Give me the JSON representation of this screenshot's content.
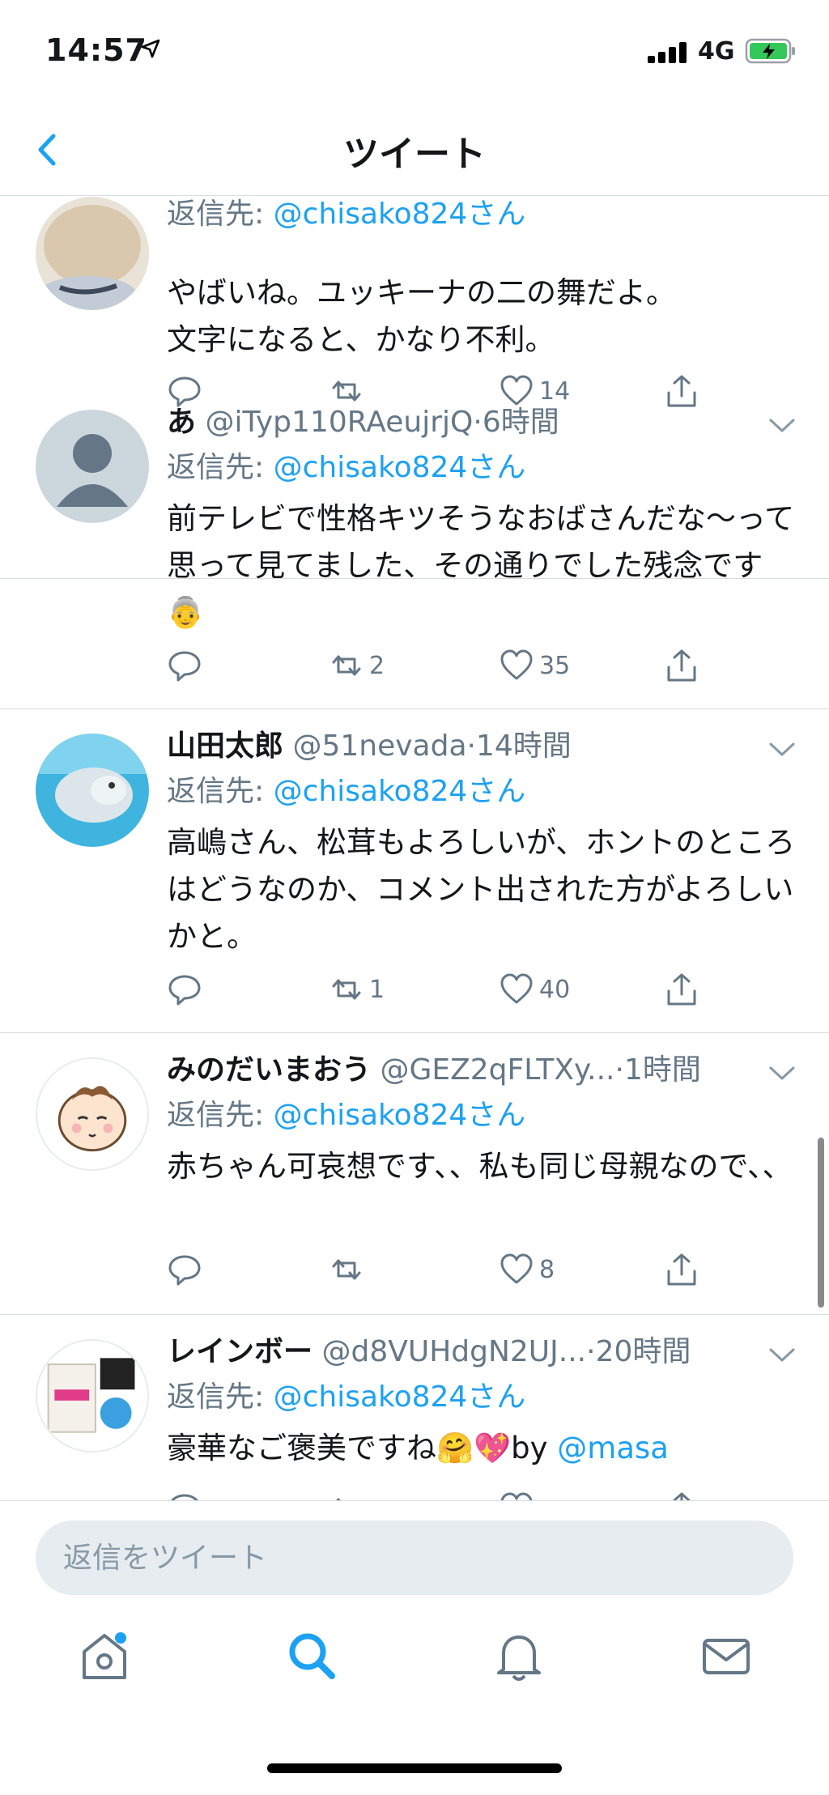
{
  "status_bar": {
    "time": "14:57",
    "network": "4G"
  },
  "header": {
    "title": "ツイート"
  },
  "tweets": [
    {
      "name": "",
      "handle": "",
      "time": "",
      "reply_to_prefix": "返信先: ",
      "reply_to_user": "@chisako824さん",
      "text": "やばいね。ユッキーナの二の舞だよ。\n文字になると、かなり不利。",
      "retweets": "",
      "likes": "14"
    },
    {
      "name": "あ",
      "handle": "@iTyp110RAeujrjQ",
      "time": "6時間",
      "reply_to_prefix": "返信先: ",
      "reply_to_user": "@chisako824さん",
      "text": "前テレビで性格キツそうなおばさんだな〜って思って見てました、その通りでした残念です👵",
      "retweets": "2",
      "likes": "35"
    },
    {
      "name": "山田太郎",
      "handle": "@51nevada",
      "time": "14時間",
      "reply_to_prefix": "返信先: ",
      "reply_to_user": "@chisako824さん",
      "text": "高嶋さん、松茸もよろしいが、ホントのところはどうなのか、コメント出された方がよろしいかと。",
      "retweets": "1",
      "likes": "40"
    },
    {
      "name": "みのだいまおう",
      "handle": "@GEZ2qFLTXy...",
      "time": "1時間",
      "reply_to_prefix": "返信先: ",
      "reply_to_user": "@chisako824さん",
      "text": "赤ちゃん可哀想です、、私も同じ母親なので、、",
      "retweets": "",
      "likes": "8"
    },
    {
      "name": "レインボー",
      "handle": "@d8VUHdgN2UJ...",
      "time": "20時間",
      "reply_to_prefix": "返信先: ",
      "reply_to_user": "@chisako824さん",
      "text": "豪華なご褒美ですね🤗💖by ",
      "text_mention": "@masa",
      "retweets": "",
      "likes": ""
    }
  ],
  "dot_separator": "·",
  "composer": {
    "placeholder": "返信をツイート"
  },
  "tabbar": [
    "home-icon",
    "search-icon",
    "notifications-icon",
    "messages-icon"
  ],
  "colors": {
    "accent": "#1da1f2",
    "secondary_text": "#657786",
    "divider": "#d8dde1",
    "composer_bg": "#e6ecf0"
  }
}
